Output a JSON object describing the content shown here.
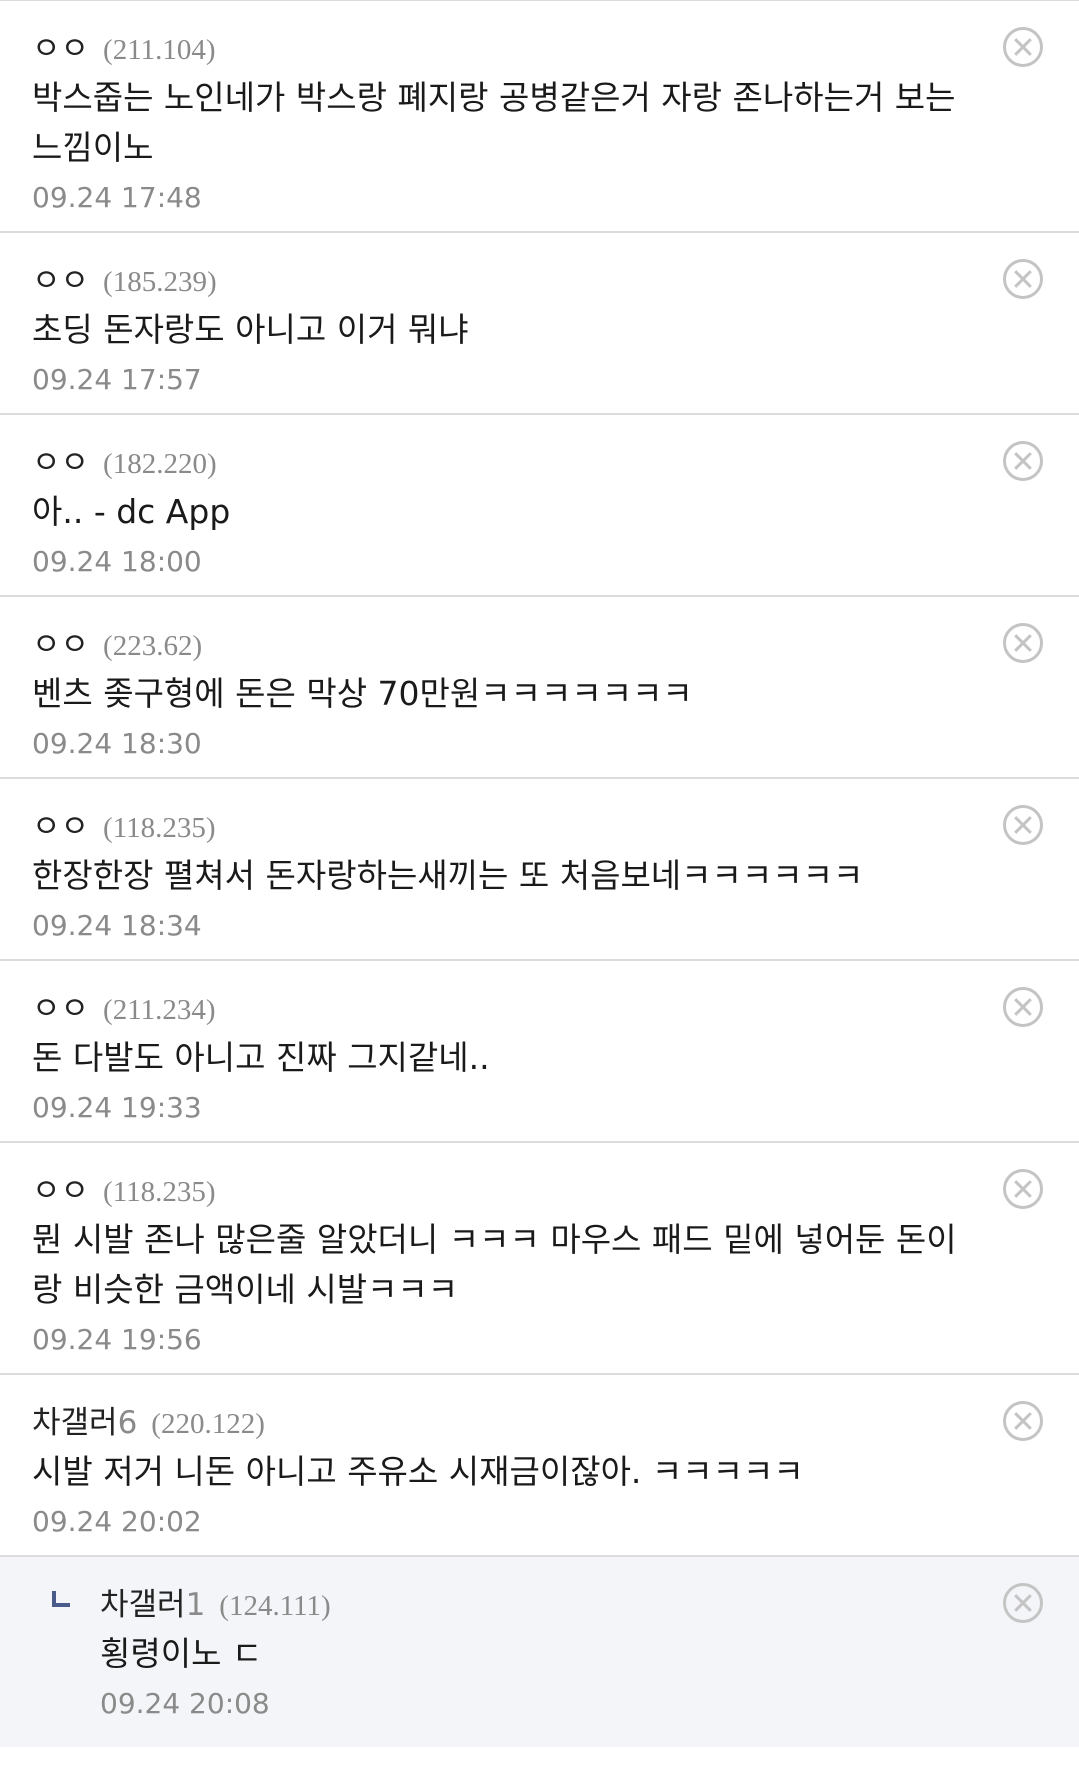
{
  "comments": [
    {
      "nick": "ㅇㅇ",
      "nick_num": "",
      "ip": "(211.104)",
      "text": "박스줍는 노인네가 박스랑 폐지랑 공병같은거 자랑 존나하는거 보는느낌이노",
      "date": "09.24 17:48"
    },
    {
      "nick": "ㅇㅇ",
      "nick_num": "",
      "ip": "(185.239)",
      "text": "초딩 돈자랑도 아니고 이거 뭐냐",
      "date": "09.24 17:57"
    },
    {
      "nick": "ㅇㅇ",
      "nick_num": "",
      "ip": "(182.220)",
      "text": "아.. - dc App",
      "date": "09.24 18:00"
    },
    {
      "nick": "ㅇㅇ",
      "nick_num": "",
      "ip": "(223.62)",
      "text": "벤츠 좆구형에 돈은 막상 70만원ㅋㅋㅋㅋㅋㅋㅋ",
      "date": "09.24 18:30"
    },
    {
      "nick": "ㅇㅇ",
      "nick_num": "",
      "ip": "(118.235)",
      "text": "한장한장 펼쳐서 돈자랑하는새끼는 또 처음보네ㅋㅋㅋㅋㅋㅋ",
      "date": "09.24 18:34"
    },
    {
      "nick": "ㅇㅇ",
      "nick_num": "",
      "ip": "(211.234)",
      "text": "돈 다발도 아니고 진짜 그지같네..",
      "date": "09.24 19:33"
    },
    {
      "nick": "ㅇㅇ",
      "nick_num": "",
      "ip": "(118.235)",
      "text": "뭔 시발 존나 많은줄 알았더니 ㅋㅋㅋ 마우스 패드 밑에 넣어둔 돈이랑 비슷한 금액이네 시발ㅋㅋㅋ",
      "date": "09.24 19:56"
    },
    {
      "nick": "차갤러",
      "nick_num": "6",
      "ip": "(220.122)",
      "text": "시발 저거 니돈 아니고 주유소 시재금이잖아. ㅋㅋㅋㅋㅋ",
      "date": "09.24 20:02"
    }
  ],
  "reply": {
    "nick": "차갤러",
    "nick_num": "1",
    "ip": "(124.111)",
    "text": "횡령이노 ㄷ",
    "date": "09.24 20:08"
  },
  "icons": {
    "delete": "close-circle-icon",
    "reply": "reply-arrow-icon"
  },
  "colors": {
    "reply_bg": "#f4f5f8",
    "meta_gray": "#8a8a8a",
    "divider": "#dcdcdc",
    "reply_arrow": "#4a5a8a"
  }
}
